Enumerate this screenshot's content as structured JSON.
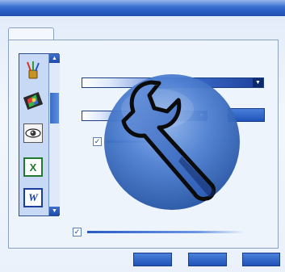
{
  "window": {
    "accent": "#2e63c8",
    "panel_border": "#8aa3c4"
  },
  "app_list": {
    "icons": [
      {
        "name": "paint-brushes-icon"
      },
      {
        "name": "photo-editor-icon"
      },
      {
        "name": "eye-viewer-icon"
      },
      {
        "name": "excel-icon",
        "letter": "X"
      },
      {
        "name": "word-icon",
        "letter": "W"
      }
    ]
  },
  "controls": {
    "checkbox_mark": "✓",
    "dropdown_arrow": "▼",
    "scroll_up": "▲",
    "scroll_down": "▼"
  },
  "overlay": {
    "icon": "wrench-icon",
    "color": "#3a6fc8"
  }
}
